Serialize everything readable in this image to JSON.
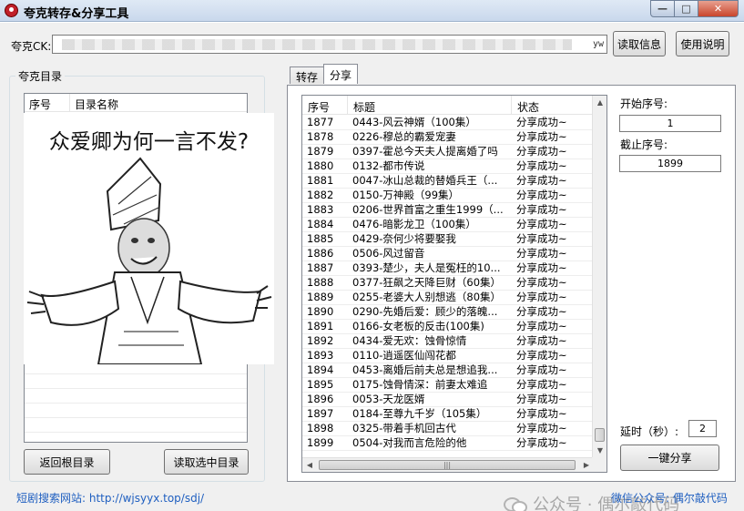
{
  "window": {
    "title": "夸克转存&分享工具"
  },
  "ck": {
    "label": "夸克CK:",
    "value_tail": "yw"
  },
  "buttons": {
    "read_info": "读取信息",
    "help": "使用说明",
    "back_root": "返回根目录",
    "read_selected": "读取选中目录",
    "share_all": "一键分享"
  },
  "directory": {
    "group_title": "夸克目录",
    "columns": [
      "序号",
      "目录名称"
    ],
    "meme_caption": "众爱卿为何一言不发?"
  },
  "tabs": [
    {
      "label": "转存",
      "active": false
    },
    {
      "label": "分享",
      "active": true
    }
  ],
  "share_table": {
    "columns": [
      "序号",
      "标题",
      "状态"
    ],
    "rows": [
      [
        "1877",
        "0443-风云神婿（100集）",
        "分享成功~"
      ],
      [
        "1878",
        "0226-穆总的霸爱宠妻",
        "分享成功~"
      ],
      [
        "1879",
        "0397-霍总今天夫人提离婚了吗",
        "分享成功~"
      ],
      [
        "1880",
        "0132-都市传说",
        "分享成功~"
      ],
      [
        "1881",
        "0047-冰山总裁的替婚兵王（...",
        "分享成功~"
      ],
      [
        "1882",
        "0150-万神殿（99集）",
        "分享成功~"
      ],
      [
        "1883",
        "0206-世界首富之重生1999（...",
        "分享成功~"
      ],
      [
        "1884",
        "0476-暗影龙卫（100集）",
        "分享成功~"
      ],
      [
        "1885",
        "0429-奈何少将要娶我",
        "分享成功~"
      ],
      [
        "1886",
        "0506-风过留音",
        "分享成功~"
      ],
      [
        "1887",
        "0393-楚少，夫人是冤枉的10...",
        "分享成功~"
      ],
      [
        "1888",
        "0377-狂飙之天降巨财（60集）",
        "分享成功~"
      ],
      [
        "1889",
        "0255-老婆大人别想逃（80集）",
        "分享成功~"
      ],
      [
        "1890",
        "0290-先婚后爱：顾少的落魄...",
        "分享成功~"
      ],
      [
        "1891",
        "0166-女老板的反击(100集)",
        "分享成功~"
      ],
      [
        "1892",
        "0434-爱无欢：蚀骨惊情",
        "分享成功~"
      ],
      [
        "1893",
        "0110-逍遥医仙闯花都",
        "分享成功~"
      ],
      [
        "1894",
        "0453-离婚后前夫总是想追我...",
        "分享成功~"
      ],
      [
        "1895",
        "0175-蚀骨情深：前妻太难追",
        "分享成功~"
      ],
      [
        "1896",
        "0053-天龙医婿",
        "分享成功~"
      ],
      [
        "1897",
        "0184-至尊九千岁（105集）",
        "分享成功~"
      ],
      [
        "1898",
        "0325-带着手机回古代",
        "分享成功~"
      ],
      [
        "1899",
        "0504-对我而言危险的他",
        "分享成功~"
      ]
    ]
  },
  "settings": {
    "start_label": "开始序号:",
    "start_value": "1",
    "end_label": "截止序号:",
    "end_value": "1899",
    "delay_label": "延时（秒）:",
    "delay_value": "2"
  },
  "footer": {
    "left_link": "短剧搜索网站: http://wjsyyx.top/sdj/",
    "right_text": "微信公众号: 偶尔敲代码",
    "watermark": "公众号 · 偶尔敲代码"
  },
  "window_controls": {
    "min": "—",
    "max": "□",
    "close": "✕"
  }
}
